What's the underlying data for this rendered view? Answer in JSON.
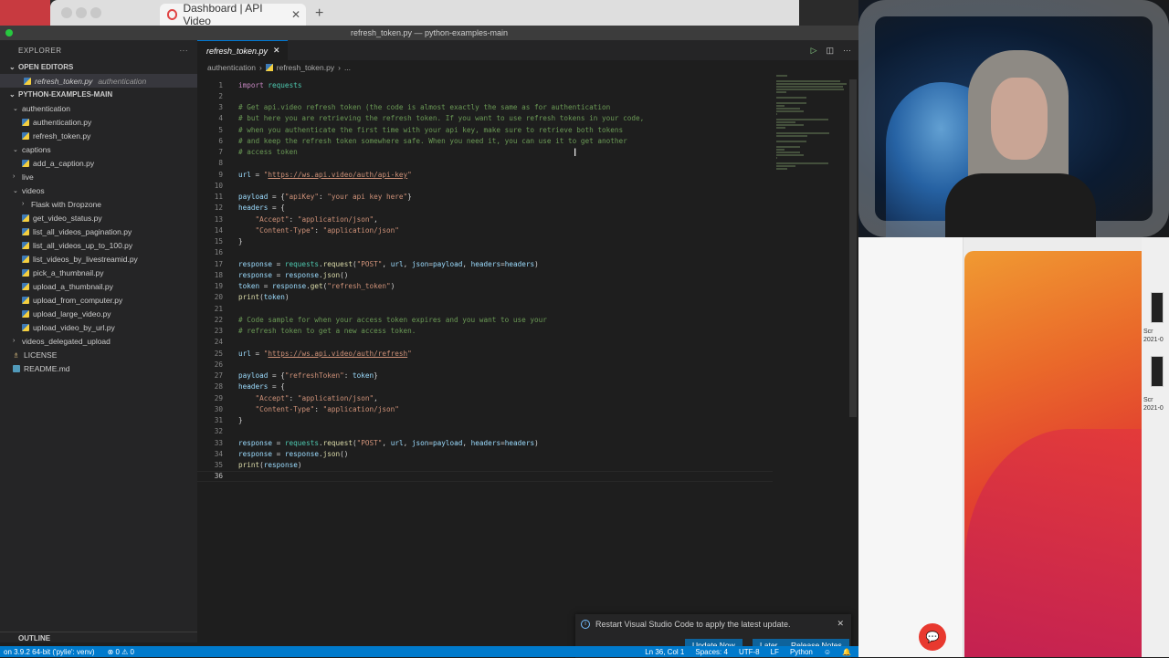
{
  "browser": {
    "tab_title": "Dashboard | API Video",
    "close_glyph": "✕",
    "new_tab_glyph": "+"
  },
  "window": {
    "title": "refresh_token.py — python-examples-main"
  },
  "explorer": {
    "header": "EXPLORER",
    "more_glyph": "···",
    "open_editors_label": "OPEN EDITORS",
    "open_editor": {
      "file": "refresh_token.py",
      "folder": "authentication",
      "close_glyph": "✕"
    },
    "project_label": "PYTHON-EXAMPLES-MAIN",
    "tree": [
      {
        "label": "authentication",
        "type": "folder",
        "depth": 1,
        "open": true
      },
      {
        "label": "authentication.py",
        "type": "py",
        "depth": 2
      },
      {
        "label": "refresh_token.py",
        "type": "py",
        "depth": 2
      },
      {
        "label": "captions",
        "type": "folder",
        "depth": 1,
        "open": true
      },
      {
        "label": "add_a_caption.py",
        "type": "py",
        "depth": 2
      },
      {
        "label": "live",
        "type": "folder",
        "depth": 1,
        "open": false
      },
      {
        "label": "videos",
        "type": "folder",
        "depth": 1,
        "open": true
      },
      {
        "label": "Flask with Dropzone",
        "type": "folder",
        "depth": 2,
        "open": false
      },
      {
        "label": "get_video_status.py",
        "type": "py",
        "depth": 2
      },
      {
        "label": "list_all_videos_pagination.py",
        "type": "py",
        "depth": 2
      },
      {
        "label": "list_all_videos_up_to_100.py",
        "type": "py",
        "depth": 2
      },
      {
        "label": "list_videos_by_livestreamid.py",
        "type": "py",
        "depth": 2
      },
      {
        "label": "pick_a_thumbnail.py",
        "type": "py",
        "depth": 2
      },
      {
        "label": "upload_a_thumbnail.py",
        "type": "py",
        "depth": 2
      },
      {
        "label": "upload_from_computer.py",
        "type": "py",
        "depth": 2
      },
      {
        "label": "upload_large_video.py",
        "type": "py",
        "depth": 2
      },
      {
        "label": "upload_video_by_url.py",
        "type": "py",
        "depth": 2
      },
      {
        "label": "videos_delegated_upload",
        "type": "folder",
        "depth": 1,
        "open": false
      },
      {
        "label": "LICENSE",
        "type": "license",
        "depth": 1
      },
      {
        "label": "README.md",
        "type": "md",
        "depth": 1
      }
    ],
    "outline_label": "OUTLINE"
  },
  "editor": {
    "tab_label": "refresh_token.py",
    "tab_close_glyph": "✕",
    "actions": {
      "run": "▷",
      "split": "◫",
      "more": "···"
    },
    "breadcrumb": [
      "authentication",
      "›",
      "refresh_token.py",
      "›",
      "..."
    ],
    "current_line": 36,
    "lines": [
      [
        {
          "t": "import",
          "c": "kw"
        },
        {
          "t": " "
        },
        {
          "t": "requests",
          "c": "mod"
        }
      ],
      [],
      [
        {
          "t": "# Get api.video refresh token (the code is almost exactly the same as for authentication",
          "c": "cm"
        }
      ],
      [
        {
          "t": "# but here you are retrieving the refresh token. If you want to use refresh tokens in your code,",
          "c": "cm"
        }
      ],
      [
        {
          "t": "# when you authenticate the first time with your api key, make sure to retrieve both tokens",
          "c": "cm"
        }
      ],
      [
        {
          "t": "# and keep the refresh token somewhere safe. When you need it, you can use it to get another",
          "c": "cm"
        }
      ],
      [
        {
          "t": "# access token",
          "c": "cm"
        }
      ],
      [],
      [
        {
          "t": "url",
          "c": "var"
        },
        {
          "t": " = "
        },
        {
          "t": "\"",
          "c": "str"
        },
        {
          "t": "https://ws.api.video/auth/api-key",
          "c": "url"
        },
        {
          "t": "\"",
          "c": "str"
        }
      ],
      [],
      [
        {
          "t": "payload",
          "c": "var"
        },
        {
          "t": " = {"
        },
        {
          "t": "\"apiKey\"",
          "c": "str"
        },
        {
          "t": ": "
        },
        {
          "t": "\"your api key here\"",
          "c": "str"
        },
        {
          "t": "}"
        }
      ],
      [
        {
          "t": "headers",
          "c": "var"
        },
        {
          "t": " = {"
        }
      ],
      [
        {
          "t": "    "
        },
        {
          "t": "\"Accept\"",
          "c": "str"
        },
        {
          "t": ": "
        },
        {
          "t": "\"application/json\"",
          "c": "str"
        },
        {
          "t": ","
        }
      ],
      [
        {
          "t": "    "
        },
        {
          "t": "\"Content-Type\"",
          "c": "str"
        },
        {
          "t": ": "
        },
        {
          "t": "\"application/json\"",
          "c": "str"
        }
      ],
      [
        {
          "t": "}"
        }
      ],
      [],
      [
        {
          "t": "response",
          "c": "var"
        },
        {
          "t": " = "
        },
        {
          "t": "requests",
          "c": "mod"
        },
        {
          "t": "."
        },
        {
          "t": "request",
          "c": "fn"
        },
        {
          "t": "("
        },
        {
          "t": "\"POST\"",
          "c": "str"
        },
        {
          "t": ", "
        },
        {
          "t": "url",
          "c": "var"
        },
        {
          "t": ", "
        },
        {
          "t": "json",
          "c": "var"
        },
        {
          "t": "="
        },
        {
          "t": "payload",
          "c": "var"
        },
        {
          "t": ", "
        },
        {
          "t": "headers",
          "c": "var"
        },
        {
          "t": "="
        },
        {
          "t": "headers",
          "c": "var"
        },
        {
          "t": ")"
        }
      ],
      [
        {
          "t": "response",
          "c": "var"
        },
        {
          "t": " = "
        },
        {
          "t": "response",
          "c": "var"
        },
        {
          "t": "."
        },
        {
          "t": "json",
          "c": "fn"
        },
        {
          "t": "()"
        }
      ],
      [
        {
          "t": "token",
          "c": "var"
        },
        {
          "t": " = "
        },
        {
          "t": "response",
          "c": "var"
        },
        {
          "t": "."
        },
        {
          "t": "get",
          "c": "fn"
        },
        {
          "t": "("
        },
        {
          "t": "\"refresh_token\"",
          "c": "str"
        },
        {
          "t": ")"
        }
      ],
      [
        {
          "t": "print",
          "c": "fn"
        },
        {
          "t": "("
        },
        {
          "t": "token",
          "c": "var"
        },
        {
          "t": ")"
        }
      ],
      [],
      [
        {
          "t": "# Code sample for when your access token expires and you want to use your",
          "c": "cm"
        }
      ],
      [
        {
          "t": "# refresh token to get a new access token.",
          "c": "cm"
        }
      ],
      [],
      [
        {
          "t": "url",
          "c": "var"
        },
        {
          "t": " = "
        },
        {
          "t": "\"",
          "c": "str"
        },
        {
          "t": "https://ws.api.video/auth/refresh",
          "c": "url"
        },
        {
          "t": "\"",
          "c": "str"
        }
      ],
      [],
      [
        {
          "t": "payload",
          "c": "var"
        },
        {
          "t": " = {"
        },
        {
          "t": "\"refreshToken\"",
          "c": "str"
        },
        {
          "t": ": "
        },
        {
          "t": "token",
          "c": "var"
        },
        {
          "t": "}"
        }
      ],
      [
        {
          "t": "headers",
          "c": "var"
        },
        {
          "t": " = {"
        }
      ],
      [
        {
          "t": "    "
        },
        {
          "t": "\"Accept\"",
          "c": "str"
        },
        {
          "t": ": "
        },
        {
          "t": "\"application/json\"",
          "c": "str"
        },
        {
          "t": ","
        }
      ],
      [
        {
          "t": "    "
        },
        {
          "t": "\"Content-Type\"",
          "c": "str"
        },
        {
          "t": ": "
        },
        {
          "t": "\"application/json\"",
          "c": "str"
        }
      ],
      [
        {
          "t": "}"
        }
      ],
      [],
      [
        {
          "t": "response",
          "c": "var"
        },
        {
          "t": " = "
        },
        {
          "t": "requests",
          "c": "mod"
        },
        {
          "t": "."
        },
        {
          "t": "request",
          "c": "fn"
        },
        {
          "t": "("
        },
        {
          "t": "\"POST\"",
          "c": "str"
        },
        {
          "t": ", "
        },
        {
          "t": "url",
          "c": "var"
        },
        {
          "t": ", "
        },
        {
          "t": "json",
          "c": "var"
        },
        {
          "t": "="
        },
        {
          "t": "payload",
          "c": "var"
        },
        {
          "t": ", "
        },
        {
          "t": "headers",
          "c": "var"
        },
        {
          "t": "="
        },
        {
          "t": "headers",
          "c": "var"
        },
        {
          "t": ")"
        }
      ],
      [
        {
          "t": "response",
          "c": "var"
        },
        {
          "t": " = "
        },
        {
          "t": "response",
          "c": "var"
        },
        {
          "t": "."
        },
        {
          "t": "json",
          "c": "fn"
        },
        {
          "t": "()"
        }
      ],
      [
        {
          "t": "print",
          "c": "fn"
        },
        {
          "t": "("
        },
        {
          "t": "response",
          "c": "var"
        },
        {
          "t": ")"
        }
      ],
      []
    ]
  },
  "notification": {
    "message": "Restart Visual Studio Code to apply the latest update.",
    "info_glyph": "i",
    "close_glyph": "✕",
    "buttons": {
      "update_now": "Update Now",
      "later": "Later",
      "release_notes": "Release Notes"
    }
  },
  "statusbar": {
    "interpreter": "on 3.9.2 64-bit ('pylie': venv)",
    "problems": "⊗ 0 ⚠ 0",
    "position": "Ln 36, Col 1",
    "spaces": "Spaces: 4",
    "encoding": "UTF-8",
    "eol": "LF",
    "language": "Python"
  },
  "desktop": {
    "icon_labels": [
      "Scr",
      "2021-0",
      "Scr",
      "2021-0"
    ]
  },
  "colors": {
    "statusbar": "#007acc",
    "accent_button": "#0e639c",
    "chat_bubble": "#e8392f"
  }
}
